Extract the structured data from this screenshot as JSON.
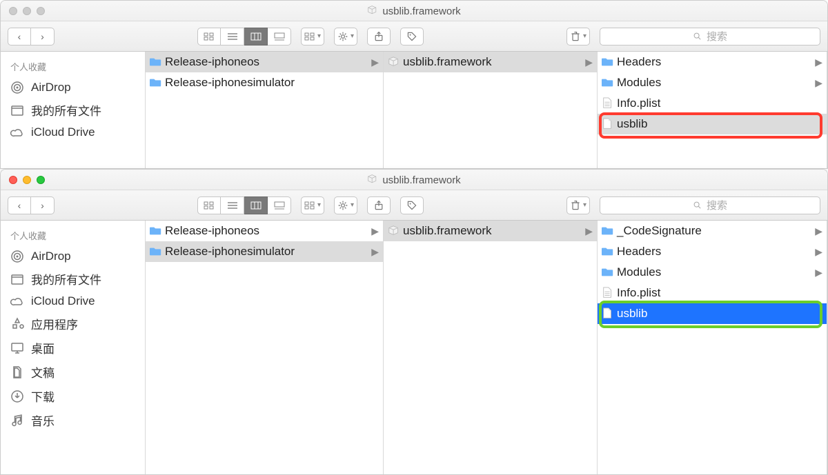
{
  "window1": {
    "title": "usblib.framework",
    "traffic_active": false,
    "search_placeholder": "搜索",
    "sidebar_header": "个人收藏",
    "sidebar": [
      {
        "icon": "airdrop",
        "label": "AirDrop"
      },
      {
        "icon": "folder-user",
        "label": "我的所有文件"
      },
      {
        "icon": "cloud",
        "label": "iCloud Drive"
      }
    ],
    "col1": [
      {
        "type": "folder",
        "label": "Release-iphoneos",
        "selected": true,
        "nav": true
      },
      {
        "type": "folder",
        "label": "Release-iphonesimulator",
        "selected": false,
        "nav": false
      }
    ],
    "col2": [
      {
        "type": "framework",
        "label": "usblib.framework",
        "selected": true,
        "nav": true
      }
    ],
    "col3": [
      {
        "type": "folder",
        "label": "Headers",
        "nav": true
      },
      {
        "type": "folder",
        "label": "Modules",
        "nav": true
      },
      {
        "type": "plist",
        "label": "Info.plist"
      },
      {
        "type": "file",
        "label": "usblib",
        "highlight": "red"
      }
    ]
  },
  "window2": {
    "title": "usblib.framework",
    "traffic_active": true,
    "search_placeholder": "搜索",
    "sidebar_header": "个人收藏",
    "sidebar": [
      {
        "icon": "airdrop",
        "label": "AirDrop"
      },
      {
        "icon": "folder-user",
        "label": "我的所有文件"
      },
      {
        "icon": "cloud",
        "label": "iCloud Drive"
      },
      {
        "icon": "apps",
        "label": "应用程序"
      },
      {
        "icon": "desktop",
        "label": "桌面"
      },
      {
        "icon": "docs",
        "label": "文稿"
      },
      {
        "icon": "download",
        "label": "下载"
      },
      {
        "icon": "music",
        "label": "音乐"
      }
    ],
    "col1": [
      {
        "type": "folder",
        "label": "Release-iphoneos",
        "selected": false,
        "nav": true
      },
      {
        "type": "folder",
        "label": "Release-iphonesimulator",
        "selected": true,
        "nav": true
      }
    ],
    "col2": [
      {
        "type": "framework",
        "label": "usblib.framework",
        "selected": true,
        "nav": true
      }
    ],
    "col3": [
      {
        "type": "folder",
        "label": "_CodeSignature",
        "nav": true
      },
      {
        "type": "folder",
        "label": "Headers",
        "nav": true
      },
      {
        "type": "folder",
        "label": "Modules",
        "nav": true
      },
      {
        "type": "plist",
        "label": "Info.plist"
      },
      {
        "type": "file",
        "label": "usblib",
        "selected": true,
        "highlight": "green"
      }
    ]
  }
}
